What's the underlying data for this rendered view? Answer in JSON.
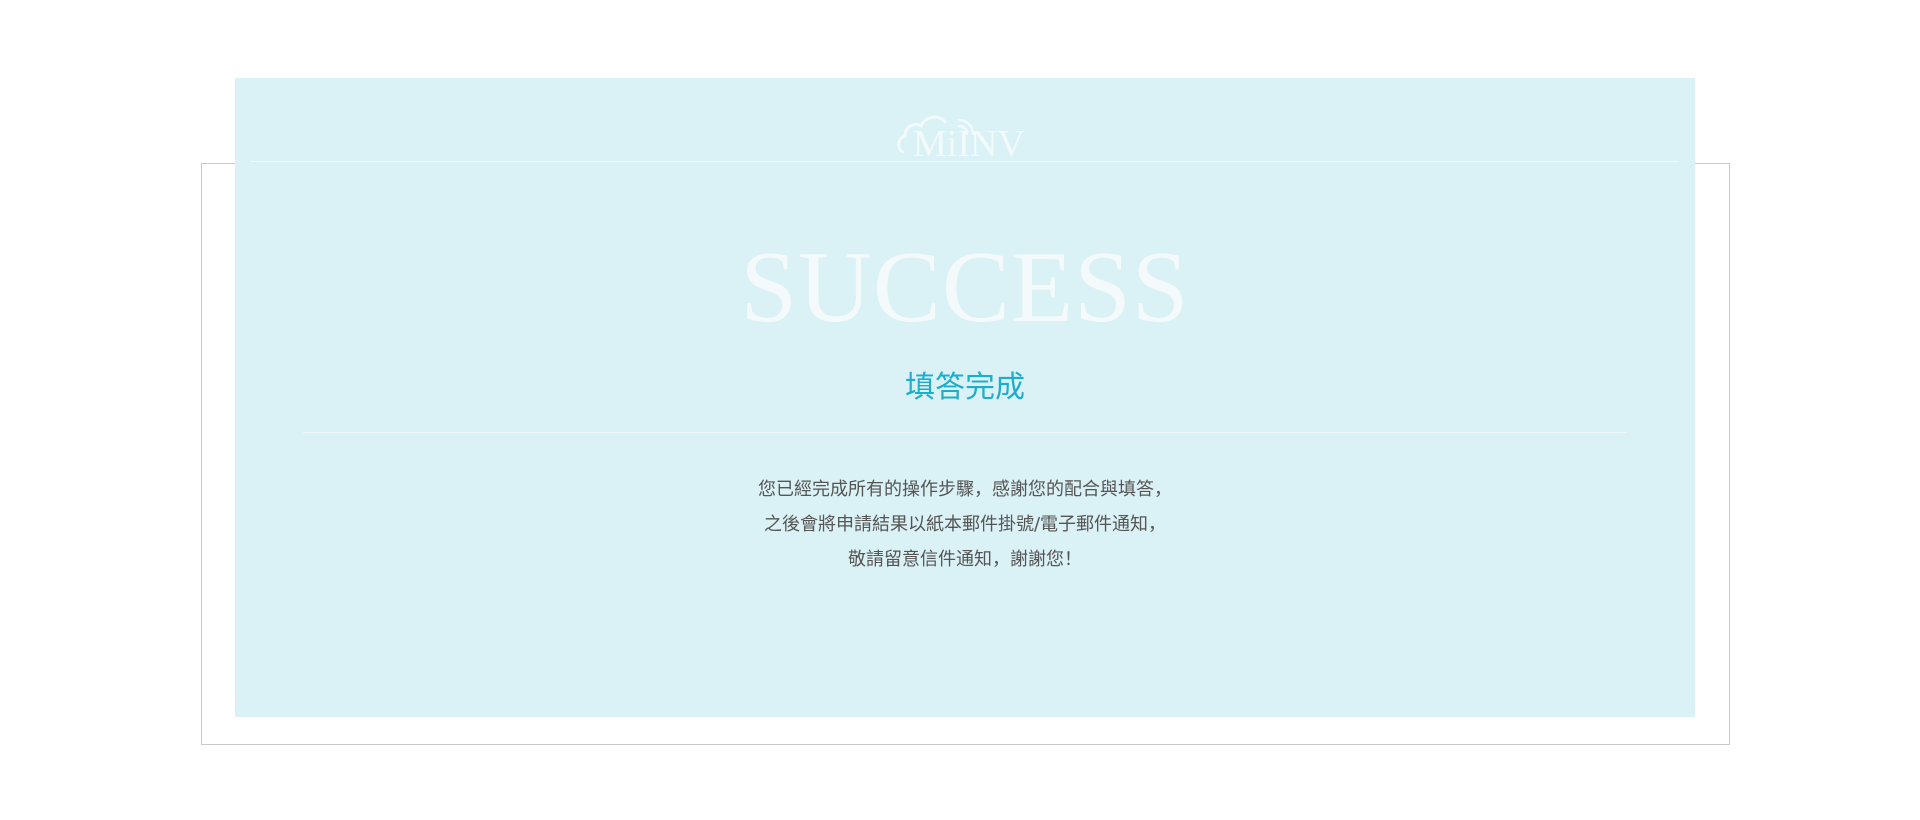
{
  "logo": {
    "text": "MiINV",
    "icon": "cloud-wifi-logo"
  },
  "hero": {
    "title": "SUCCESS"
  },
  "subtitle": "填答完成",
  "message": {
    "line1": "您已經完成所有的操作步驟，感謝您的配合與填答，",
    "line2": "之後會將申請結果以紙本郵件掛號/電子郵件通知，",
    "line3": "敬請留意信件通知，謝謝您！"
  },
  "colors": {
    "card_background": "#daf1f6",
    "accent": "#1daecd",
    "title_text": "#f4fafb",
    "body_text": "#555555",
    "frame_border": "#c9c9c9"
  }
}
